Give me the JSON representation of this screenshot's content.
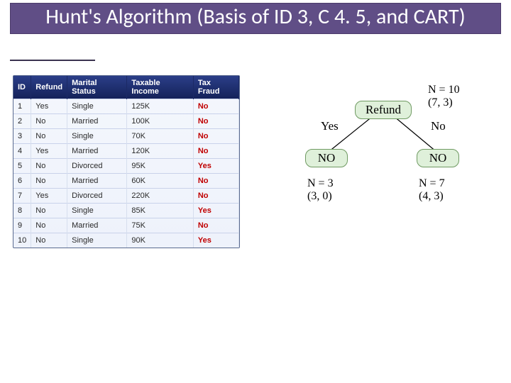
{
  "title": "Hunt's Algorithm (Basis of ID 3, C 4. 5, and CART)",
  "table": {
    "headers": [
      "ID",
      "Refund",
      "Marital Status",
      "Taxable Income",
      "Tax Fraud"
    ],
    "rows": [
      {
        "id": "1",
        "refund": "Yes",
        "marital": "Single",
        "income": "125K",
        "fraud": "No"
      },
      {
        "id": "2",
        "refund": "No",
        "marital": "Married",
        "income": "100K",
        "fraud": "No"
      },
      {
        "id": "3",
        "refund": "No",
        "marital": "Single",
        "income": "70K",
        "fraud": "No"
      },
      {
        "id": "4",
        "refund": "Yes",
        "marital": "Married",
        "income": "120K",
        "fraud": "No"
      },
      {
        "id": "5",
        "refund": "No",
        "marital": "Divorced",
        "income": "95K",
        "fraud": "Yes"
      },
      {
        "id": "6",
        "refund": "No",
        "marital": "Married",
        "income": "60K",
        "fraud": "No"
      },
      {
        "id": "7",
        "refund": "Yes",
        "marital": "Divorced",
        "income": "220K",
        "fraud": "No"
      },
      {
        "id": "8",
        "refund": "No",
        "marital": "Single",
        "income": "85K",
        "fraud": "Yes"
      },
      {
        "id": "9",
        "refund": "No",
        "marital": "Married",
        "income": "75K",
        "fraud": "No"
      },
      {
        "id": "10",
        "refund": "No",
        "marital": "Single",
        "income": "90K",
        "fraud": "Yes"
      }
    ]
  },
  "tree": {
    "root": {
      "label": "Refund",
      "stats_line1": "N = 10",
      "stats_line2": "(7, 3)"
    },
    "edges": {
      "left": "Yes",
      "right": "No"
    },
    "leaves": {
      "left": {
        "label": "NO",
        "stats_line1": "N = 3",
        "stats_line2": "(3, 0)"
      },
      "right": {
        "label": "NO",
        "stats_line1": "N = 7",
        "stats_line2": "(4, 3)"
      }
    }
  }
}
